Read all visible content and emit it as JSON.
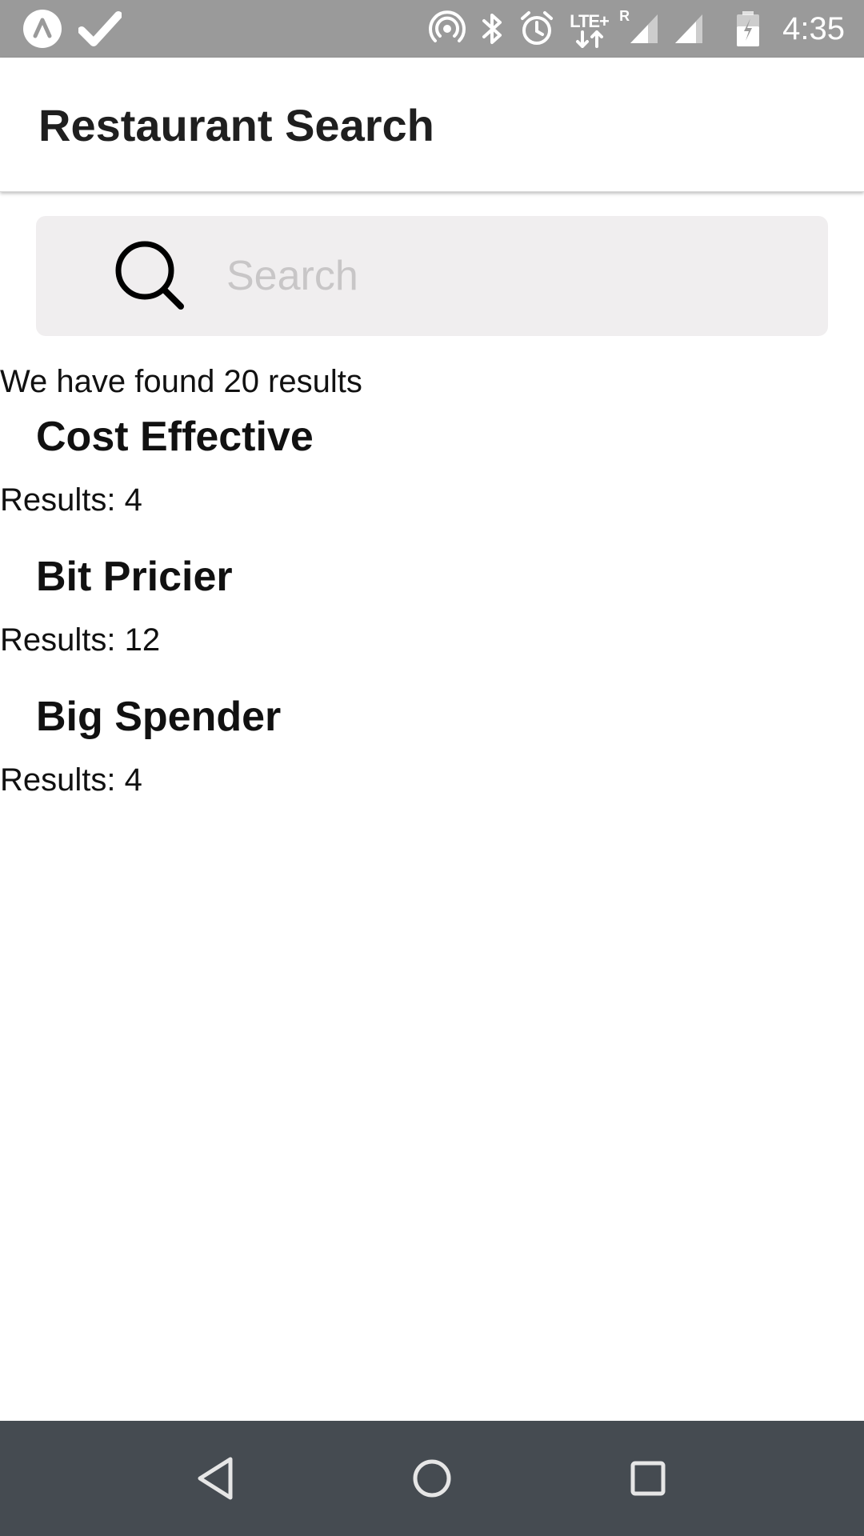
{
  "status_bar": {
    "time": "4:35",
    "network": "LTE+",
    "roaming": "R",
    "icons": [
      "app-notification-icon",
      "check-icon",
      "hotspot-icon",
      "bluetooth-icon",
      "alarm-icon",
      "lte-icon",
      "signal-icon",
      "battery-icon"
    ]
  },
  "app_bar": {
    "title": "Restaurant Search"
  },
  "search": {
    "placeholder": "Search",
    "value": ""
  },
  "results": {
    "summary": "We have found 20 results",
    "groups": [
      {
        "title": "Cost Effective",
        "count_text": "Results: 4"
      },
      {
        "title": "Bit Pricier",
        "count_text": "Results: 12"
      },
      {
        "title": "Big Spender",
        "count_text": "Results: 4"
      }
    ]
  },
  "nav_bar": {
    "buttons": [
      "back-icon",
      "home-icon",
      "recents-icon"
    ]
  },
  "colors": {
    "status_bar": "#9a9a9a",
    "search_bg": "#f0eeef",
    "placeholder": "#c8c6c7",
    "nav_bar": "#454b51"
  }
}
